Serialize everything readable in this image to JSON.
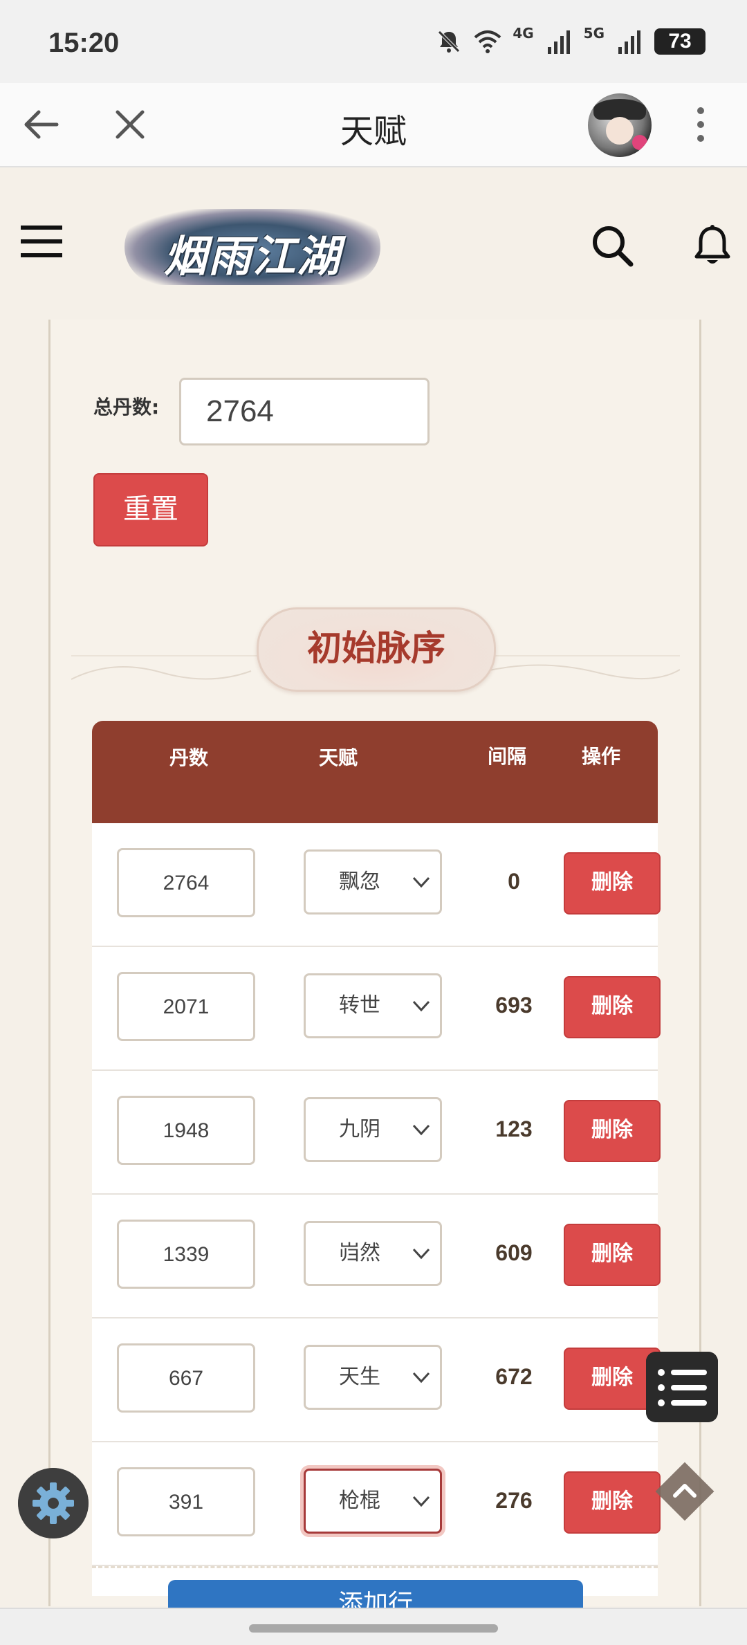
{
  "status_bar": {
    "time": "15:20",
    "network_1": "4G",
    "network_2": "5G",
    "battery": "73"
  },
  "title_bar": {
    "title": "天赋"
  },
  "site": {
    "logo_text": "烟雨江湖"
  },
  "form": {
    "total_label": "总丹数:",
    "total_value": "2764",
    "reset_label": "重置"
  },
  "section": {
    "title": "初始脉序"
  },
  "table": {
    "headers": {
      "dan": "丹数",
      "talent": "天赋",
      "gap": "间隔",
      "op": "操作"
    },
    "rows": [
      {
        "dan": "2764",
        "talent": "飘忽",
        "gap": "0",
        "action": "删除"
      },
      {
        "dan": "2071",
        "talent": "转世",
        "gap": "693",
        "action": "删除"
      },
      {
        "dan": "1948",
        "talent": "九阴",
        "gap": "123",
        "action": "删除"
      },
      {
        "dan": "1339",
        "talent": "岿然",
        "gap": "609",
        "action": "删除"
      },
      {
        "dan": "667",
        "talent": "天生",
        "gap": "672",
        "action": "删除"
      },
      {
        "dan": "391",
        "talent": "枪棍",
        "gap": "276",
        "action": "删除"
      }
    ],
    "add_label": "添加行"
  }
}
